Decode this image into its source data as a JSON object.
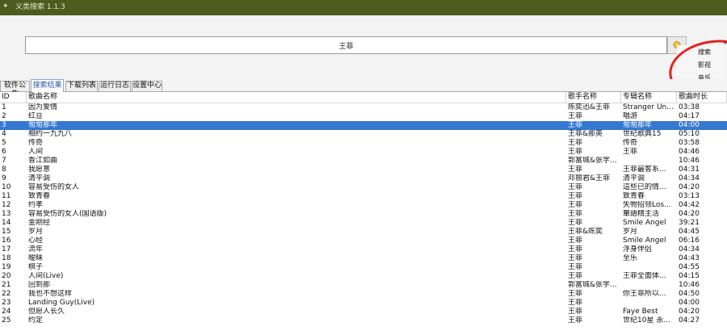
{
  "window": {
    "title": "义类搜索 1.1.3"
  },
  "search": {
    "value": "王菲",
    "button_icon": "search-icon"
  },
  "dropdown": {
    "items": [
      "搜索",
      "影视",
      "音乐"
    ]
  },
  "colors": {
    "titlebar": "#4e5b1d",
    "selection": "#3478d1",
    "annotation": "#e7211f"
  },
  "tabs": [
    "软件公告",
    "搜索结果",
    "下载列表",
    "运行日志",
    "设置中心"
  ],
  "active_tab": "搜索结果",
  "table": {
    "columns": [
      "ID",
      "歌曲名称",
      "歌手名称",
      "专辑名称",
      "歌曲时长"
    ],
    "selected_row": 3,
    "rows": [
      [
        "1",
        "因为爱情",
        "陈奕迅&王菲",
        "Stranger Un...",
        "03:38"
      ],
      [
        "2",
        "红豆",
        "王菲",
        "唱游",
        "04:17"
      ],
      [
        "3",
        "匆匆那年",
        "王菲",
        "匆匆那年",
        "04:00"
      ],
      [
        "4",
        "相约一九九八",
        "王菲&那英",
        "世纪歌典15",
        "05:10"
      ],
      [
        "5",
        "传奇",
        "王菲",
        "传奇",
        "03:58"
      ],
      [
        "6",
        "人间",
        "王菲",
        "王菲",
        "04:46"
      ],
      [
        "7",
        "香江如曲",
        "郭富城&张学...",
        "",
        "10:46"
      ],
      [
        "8",
        "我愿意",
        "王菲",
        "王菲最客系...",
        "04:31"
      ],
      [
        "9",
        "清平调",
        "邓丽君&王菲",
        "清平调",
        "04:34"
      ],
      [
        "10",
        "容易受伤的女人",
        "王菲",
        "這些已的情...",
        "04:20"
      ],
      [
        "11",
        "致青春",
        "王菲",
        "致青春",
        "03:13"
      ],
      [
        "12",
        "约孝",
        "王菲",
        "失物招领Los...",
        "04:42"
      ],
      [
        "13",
        "容易受伤的女人(国语版)",
        "王菲",
        "華語精主活",
        "04:20"
      ],
      [
        "14",
        "金刚经",
        "王菲",
        "Smile Angel",
        "39:21"
      ],
      [
        "15",
        "岁月",
        "王菲&陈奕",
        "岁月",
        "04:45"
      ],
      [
        "16",
        "心经",
        "王菲",
        "Smile Angel",
        "06:16"
      ],
      [
        "17",
        "流年",
        "王菲",
        "浮身伴侣",
        "04:34"
      ],
      [
        "18",
        "暧昧",
        "王菲",
        "至乐",
        "04:43"
      ],
      [
        "19",
        "棋子",
        "王菲",
        "",
        "04:55"
      ],
      [
        "20",
        "人间(Live)",
        "王菲",
        "王菲全面体...",
        "04:15"
      ],
      [
        "21",
        "回到那",
        "郭富城&张学...",
        "",
        "10:46"
      ],
      [
        "22",
        "我也不想这样",
        "王菲",
        "你王菲所以...",
        "04:50"
      ],
      [
        "23",
        "Landing Guy(Live)",
        "王菲",
        "",
        "04:00"
      ],
      [
        "24",
        "但愿人长久",
        "王菲",
        "Faye Best",
        "04:20"
      ],
      [
        "25",
        "约定",
        "王菲",
        "世纪10星 永...",
        "04:27"
      ]
    ]
  }
}
